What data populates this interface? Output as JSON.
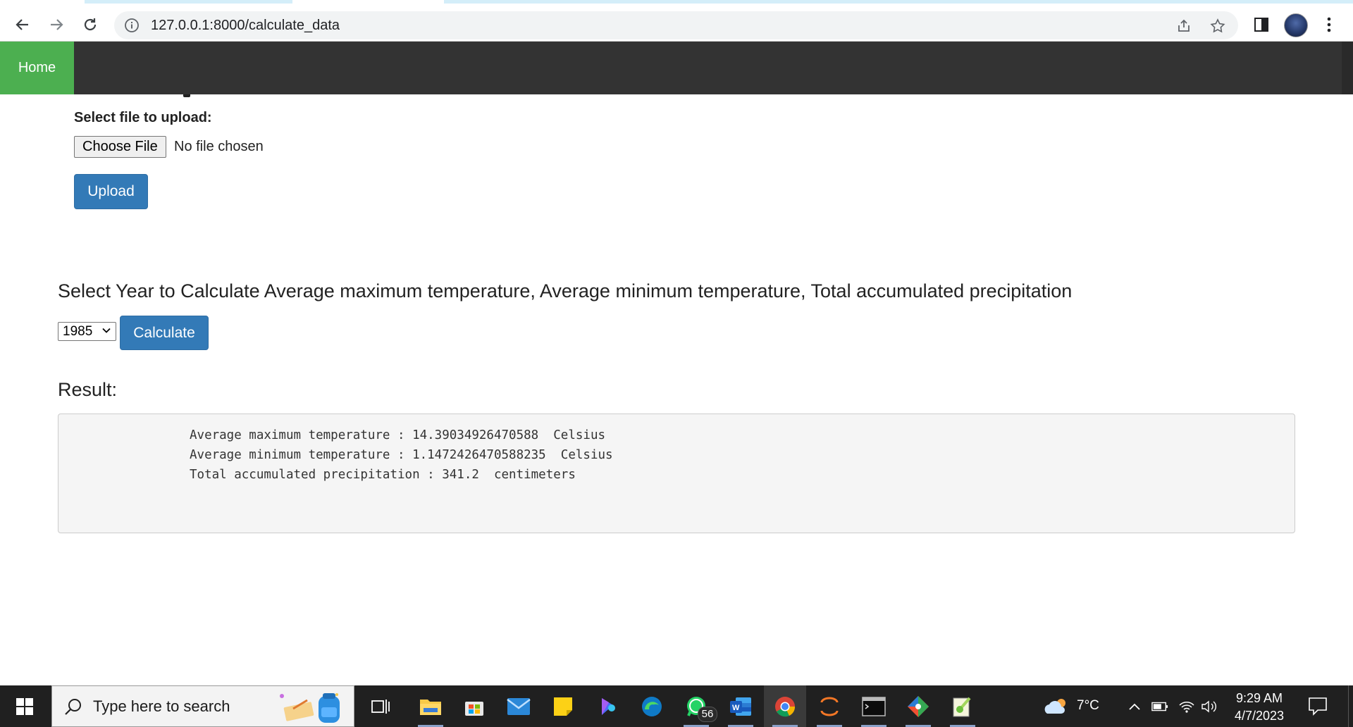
{
  "browser": {
    "url": "127.0.0.1:8000/calculate_data",
    "back_icon": "arrow-left-icon",
    "forward_icon": "arrow-right-icon",
    "reload_icon": "reload-icon"
  },
  "navbar": {
    "home_label": "Home",
    "accent": "#4caf50",
    "background": "#333333"
  },
  "upload": {
    "label": "Select file to upload:",
    "choose_button": "Choose File",
    "file_status": "No file chosen",
    "upload_button": "Upload"
  },
  "calculate": {
    "heading": "Select Year to Calculate Average maximum temperature, Average minimum temperature, Total accumulated precipitation",
    "selected_year": "1985",
    "calculate_button": "Calculate",
    "button_color": "#337ab7"
  },
  "result": {
    "heading": "Result:",
    "lines": [
      "Average maximum temperature : 14.39034926470588  Celsius",
      "Average minimum temperature : 1.1472426470588235  Celsius",
      "Total accumulated precipitation : 341.2  centimeters"
    ]
  },
  "taskbar": {
    "search_placeholder": "Type here to search",
    "whatsapp_badge": "56",
    "weather": "7°C",
    "time": "9:29 AM",
    "date": "4/7/2023"
  }
}
